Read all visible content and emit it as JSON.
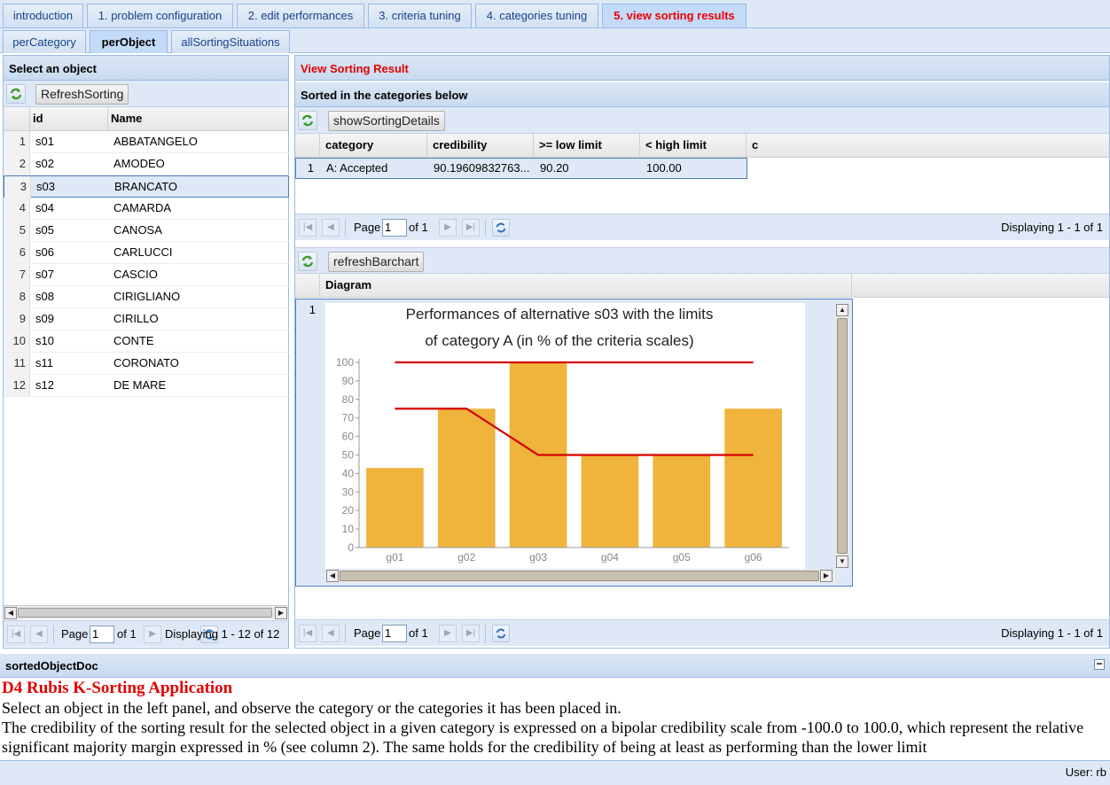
{
  "main_tabs": [
    "introduction",
    "1. problem configuration",
    "2. edit performances",
    "3. criteria tuning",
    "4. categories tuning",
    "5. view sorting results"
  ],
  "sub_tabs": [
    "perCategory",
    "perObject",
    "allSortingSituations"
  ],
  "left": {
    "title": "Select an object",
    "refresh_label": "RefreshSorting",
    "col_id": "id",
    "col_name": "Name",
    "rows": [
      {
        "n": "1",
        "id": "s01",
        "name": "ABBATANGELO"
      },
      {
        "n": "2",
        "id": "s02",
        "name": "AMODEO"
      },
      {
        "n": "3",
        "id": "s03",
        "name": "BRANCATO"
      },
      {
        "n": "4",
        "id": "s04",
        "name": "CAMARDA"
      },
      {
        "n": "5",
        "id": "s05",
        "name": "CANOSA"
      },
      {
        "n": "6",
        "id": "s06",
        "name": "CARLUCCI"
      },
      {
        "n": "7",
        "id": "s07",
        "name": "CASCIO"
      },
      {
        "n": "8",
        "id": "s08",
        "name": "CIRIGLIANO"
      },
      {
        "n": "9",
        "id": "s09",
        "name": "CIRILLO"
      },
      {
        "n": "10",
        "id": "s10",
        "name": "CONTE"
      },
      {
        "n": "11",
        "id": "s11",
        "name": "CORONATO"
      },
      {
        "n": "12",
        "id": "s12",
        "name": "DE MARE"
      }
    ],
    "pager": {
      "page_label": "Page",
      "page": "1",
      "of": "of 1",
      "displaying": "Displaying 1 - 12 of 12"
    }
  },
  "right": {
    "title": "View Sorting Result",
    "sorted_title": "Sorted in the categories below",
    "details_label": "showSortingDetails",
    "cols": [
      "category",
      "credibility",
      ">= low limit",
      "< high limit",
      "c"
    ],
    "result_row": {
      "n": "1",
      "category": "A: Accepted",
      "credibility": "90.19609832763...",
      "low": "90.20",
      "high": "100.00"
    },
    "pager1": {
      "page_label": "Page",
      "page": "1",
      "of": "of 1",
      "displaying": "Displaying 1 - 1 of 1"
    },
    "barchart_label": "refreshBarchart",
    "diagram_col": "Diagram",
    "diagram_row": "1",
    "pager2": {
      "page_label": "Page",
      "page": "1",
      "of": "of 1",
      "displaying": "Displaying 1 - 1 of 1"
    }
  },
  "chart_data": {
    "type": "bar",
    "title": "Performances of alternative s03 with the limits",
    "subtitle": "of category A (in % of the criteria scales)",
    "categories": [
      "g01",
      "g02",
      "g03",
      "g04",
      "g05",
      "g06"
    ],
    "values": [
      43,
      75,
      100,
      50,
      50,
      75
    ],
    "series": [
      {
        "values": [
          43,
          75,
          100,
          50,
          50,
          75
        ]
      },
      {
        "values": [
          100,
          100,
          100,
          100,
          100,
          100
        ]
      },
      {
        "values": [
          75,
          75,
          50,
          50,
          50,
          50
        ]
      }
    ],
    "ylim": [
      0,
      100
    ],
    "yticks": [
      "0",
      "10",
      "20",
      "30",
      "40",
      "50",
      "60",
      "70",
      "80",
      "90",
      "100"
    ],
    "bar_color": "#f0b33c",
    "line_color": "#d40000"
  },
  "doc": {
    "panel_title": "sortedObjectDoc",
    "heading": "D4 Rubis K-Sorting Application",
    "line1": "Select an object in the left panel, and observe the category or the categories it has been placed in.",
    "line2": "The credibility of the sorting result for the selected object in a given category is expressed on a bipolar credibility scale from -100.0 to 100.0, which represent the relative significant majority margin expressed in % (see column 2). The same holds for the credibility of being at least as performing than the lower limit"
  },
  "status": {
    "user": "User: rb"
  },
  "colors": {
    "accent": "#15428b",
    "active_tab": "#e00000",
    "panel_bg": "#dfe8f6"
  }
}
